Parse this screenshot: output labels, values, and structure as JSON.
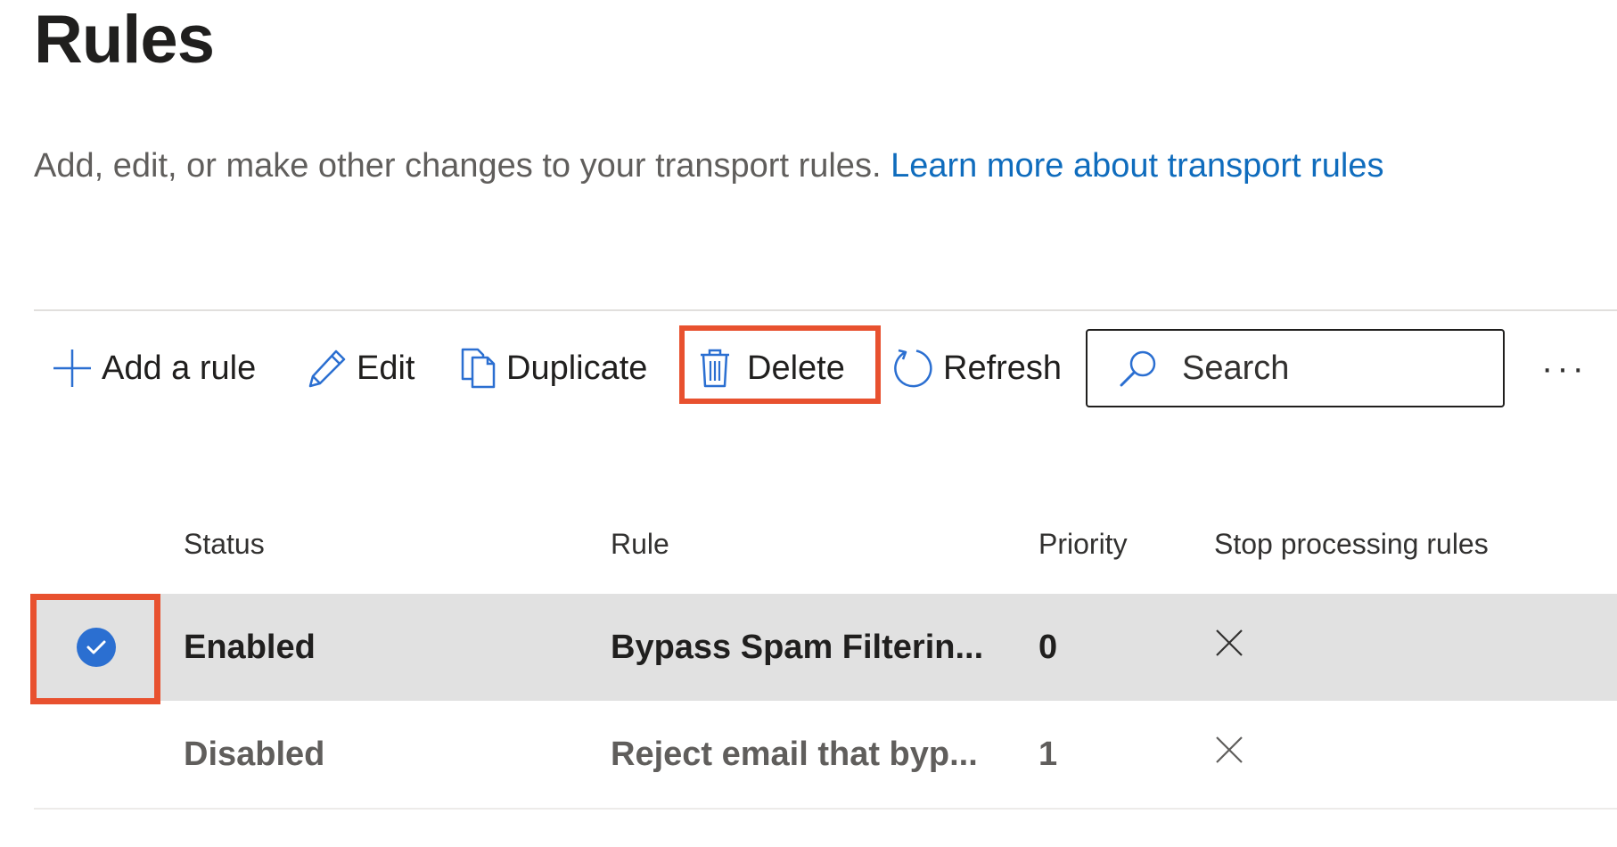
{
  "page": {
    "title": "Rules",
    "description": "Add, edit, or make other changes to your transport rules.",
    "learn_more_link": "Learn more about transport rules",
    "accent_color": "#0f6cbd",
    "highlight_color": "#e8512f"
  },
  "toolbar": {
    "add_label": "Add a rule",
    "edit_label": "Edit",
    "duplicate_label": "Duplicate",
    "delete_label": "Delete",
    "refresh_label": "Refresh",
    "search_placeholder": "Search",
    "more_label": "···"
  },
  "table": {
    "columns": [
      "Status",
      "Rule",
      "Priority",
      "Stop processing rules"
    ],
    "rows": [
      {
        "selected": true,
        "status": "Enabled",
        "rule": "Bypass Spam Filterin...",
        "priority": "0",
        "stop_processing": "x-icon"
      },
      {
        "selected": false,
        "status": "Disabled",
        "rule": "Reject email that byp...",
        "priority": "1",
        "stop_processing": "x-icon"
      }
    ]
  },
  "icons": {
    "add": "plus-icon",
    "edit": "pencil-icon",
    "duplicate": "copy-icon",
    "delete": "trash-icon",
    "refresh": "refresh-icon",
    "search": "search-icon",
    "more": "more-icon",
    "row_selected": "checkmark-circle-icon",
    "stop_processing": "x-icon"
  }
}
